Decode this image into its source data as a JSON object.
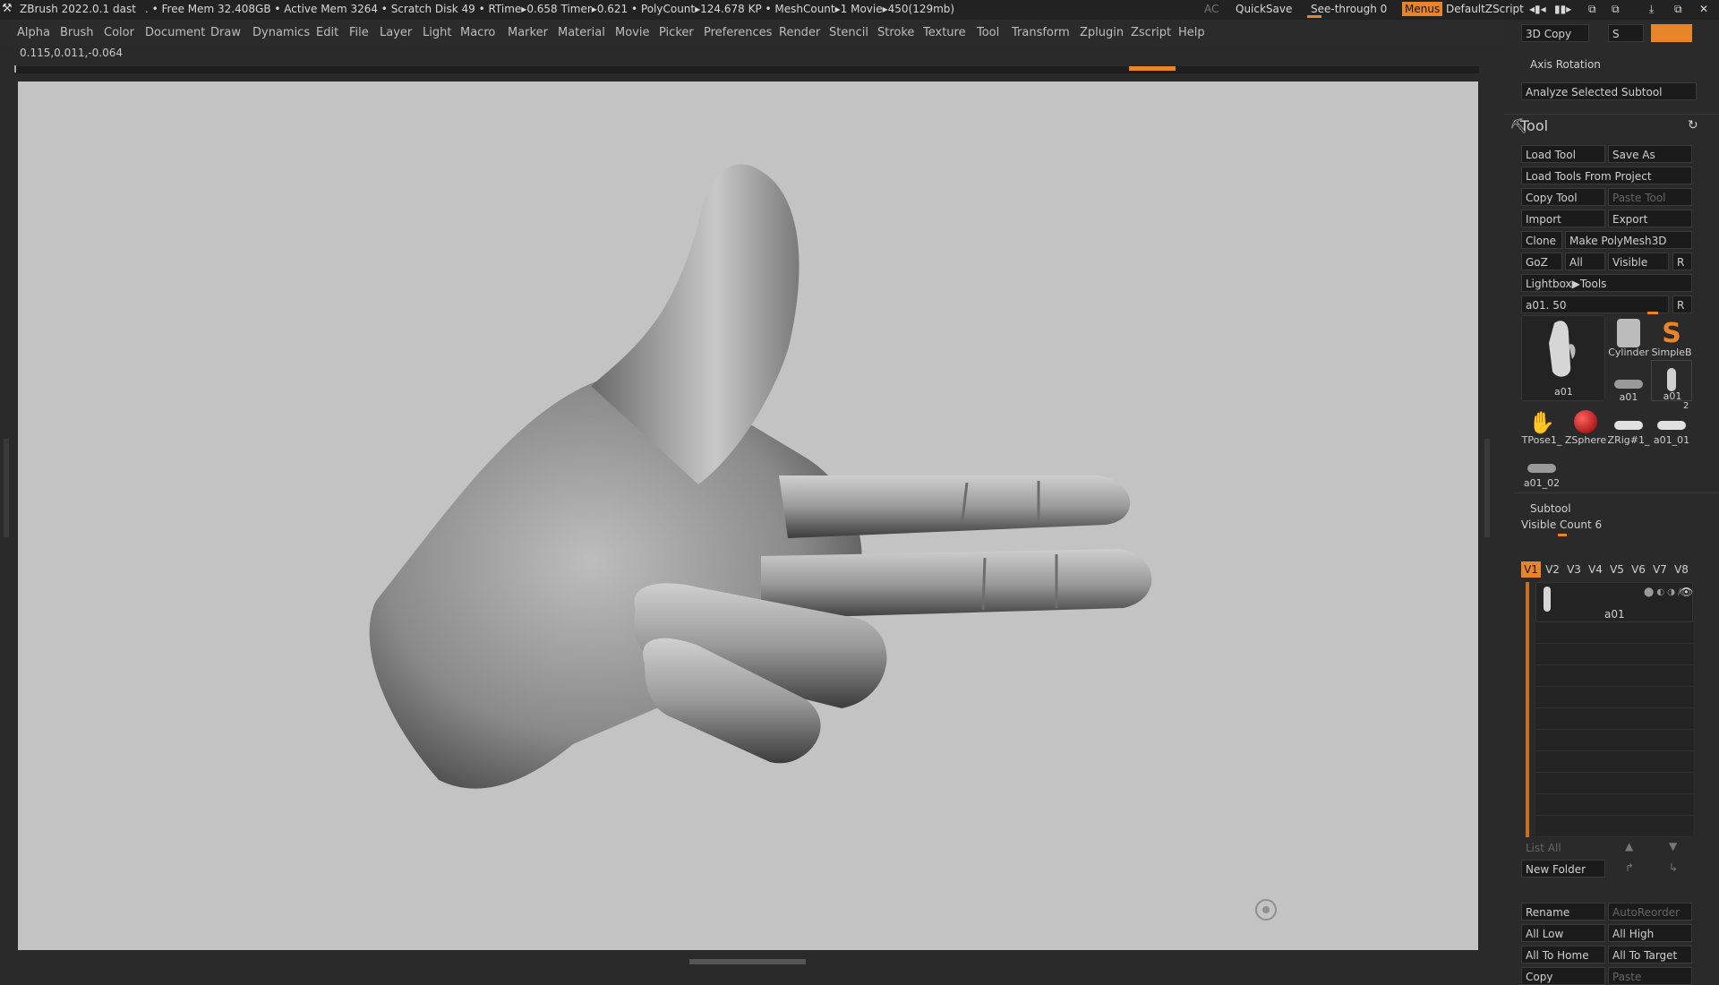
{
  "titlebar": {
    "app": "ZBrush 2022.0.1",
    "doc": "dast",
    "stats": ". • Free Mem 32.408GB • Active Mem 3264 • Scratch Disk 49 • RTime▸0.658 Timer▸0.621 • PolyCount▸124.678 KP • MeshCount▸1  Movie▸450(129mb)",
    "ac": "AC",
    "quicksave": "QuickSave",
    "seethrough": "See-through  0",
    "menus": "Menus",
    "script": "DefaultZScript"
  },
  "menubar": [
    "Alpha",
    "Brush",
    "Color",
    "Document",
    "Draw",
    "Dynamics",
    "Edit",
    "File",
    "Layer",
    "Light",
    "Macro",
    "Marker",
    "Material",
    "Movie",
    "Picker",
    "Preferences",
    "Render",
    "Stencil",
    "Stroke",
    "Texture",
    "Tool",
    "Transform",
    "Zplugin",
    "Zscript",
    "Help"
  ],
  "coords": "0.115,0.011,-0.064",
  "rpanel": {
    "copy3d": "3D Copy",
    "s_label": "S",
    "axis_rotation": "Axis Rotation",
    "analyze": "Analyze Selected Subtool",
    "tool_title": "Tool",
    "load_tool": "Load Tool",
    "save_as": "Save As",
    "load_from_project": "Load Tools From Project",
    "copy_tool": "Copy Tool",
    "paste_tool": "Paste Tool",
    "import": "Import",
    "export": "Export",
    "clone": "Clone",
    "make_polymesh": "Make PolyMesh3D",
    "goz": "GoZ",
    "all": "All",
    "visible": "Visible",
    "r": "R",
    "lightbox": "Lightbox▶Tools",
    "tool_slider": "a01. 50",
    "thumbs": [
      "a01",
      "Cylinder",
      "SimpleB",
      "a01",
      "a01",
      "TPose1_",
      "ZSphere",
      "ZRig#1_",
      "a01_01",
      "a01_02"
    ],
    "thumb_badge": "2",
    "subtool_title": "Subtool",
    "visible_count": "Visible Count 6",
    "vtabs": [
      "V1",
      "V2",
      "V3",
      "V4",
      "V5",
      "V6",
      "V7",
      "V8"
    ],
    "subtool_item": "a01",
    "list_all": "List All",
    "new_folder": "New Folder",
    "rename": "Rename",
    "autoreorder": "AutoReorder",
    "all_low": "All Low",
    "all_high": "All High",
    "all_to_home": "All To Home",
    "all_to_target": "All To Target",
    "copy": "Copy",
    "paste": "Paste"
  },
  "colors": {
    "accent": "#e8842a",
    "canvas": "#c3c3c3",
    "panel": "#2a2a2a"
  }
}
